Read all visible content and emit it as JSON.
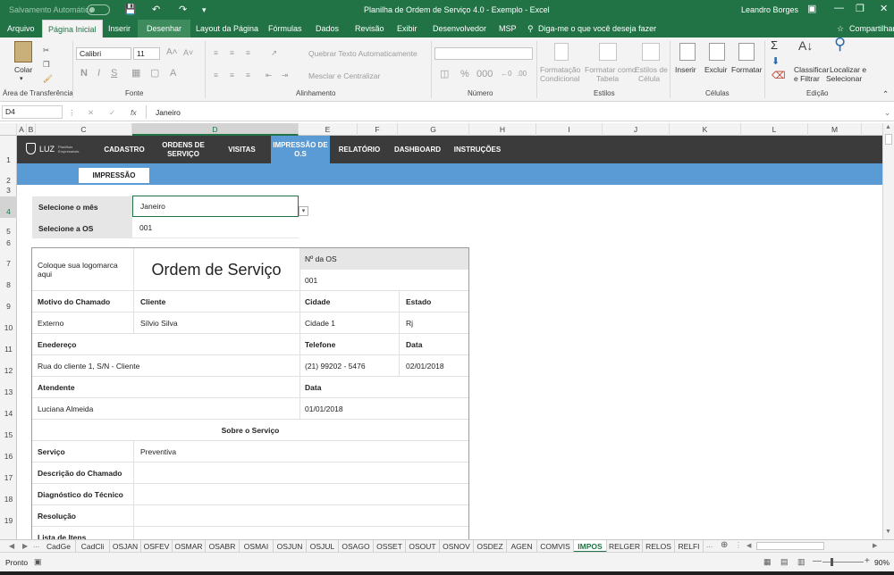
{
  "titlebar": {
    "autosave_label": "Salvamento Automático",
    "title": "Planilha de Ordem de Serviço 4.0 - Exemplo  -  Excel",
    "user": "Leandro Borges"
  },
  "menu": {
    "items": [
      "Arquivo",
      "Página Inicial",
      "Inserir",
      "Desenhar",
      "Layout da Página",
      "Fórmulas",
      "Dados",
      "Revisão",
      "Exibir",
      "Desenvolvedor",
      "MSP"
    ],
    "tell_me": "Diga-me o que você deseja fazer",
    "share": "Compartilhar"
  },
  "ribbon": {
    "paste": "Colar",
    "clipboard_group": "Área de Transferência",
    "font_name": "Calibri",
    "font_size": "11",
    "font_group": "Fonte",
    "wrap_text": "Quebrar Texto Automaticamente",
    "merge_center": "Mesclar e Centralizar",
    "alignment_group": "Alinhamento",
    "number_group": "Número",
    "cond_format_1": "Formatação",
    "cond_format_2": "Condicional",
    "format_table_1": "Formatar como",
    "format_table_2": "Tabela",
    "cell_styles_1": "Estilos de",
    "cell_styles_2": "Célula",
    "styles_group": "Estilos",
    "insert": "Inserir",
    "delete": "Excluir",
    "format": "Formatar",
    "cells_group": "Células",
    "sort_1": "Classificar",
    "sort_2": "e Filtrar",
    "find_1": "Localizar e",
    "find_2": "Selecionar",
    "editing_group": "Edição"
  },
  "formula_bar": {
    "name_box": "D4",
    "fx": "fx",
    "formula": "Janeiro"
  },
  "columns": [
    "A",
    "B",
    "C",
    "D",
    "E",
    "F",
    "G",
    "H",
    "I",
    "J",
    "K",
    "L",
    "M"
  ],
  "rows": [
    "1",
    "2",
    "3",
    "4",
    "5",
    "6",
    "7",
    "8",
    "9",
    "10",
    "11",
    "12",
    "13",
    "14",
    "15",
    "16",
    "17",
    "18",
    "19"
  ],
  "app_nav": {
    "logo_text": "LUZ",
    "logo_sub": "Planilhas Empresariais",
    "items": [
      "CADASTRO",
      "ORDENS DE SERVIÇO",
      "VISITAS",
      "IMPRESSÃO DE O.S",
      "RELATÓRIO",
      "DASHBOARD",
      "INSTRUÇÕES"
    ],
    "subtab": "IMPRESSÃO"
  },
  "selectors": {
    "month_label": "Selecione o mês",
    "month_value": "Janeiro",
    "os_label": "Selecione a OS",
    "os_value": "001"
  },
  "order": {
    "logo_placeholder": "Coloque sua logomarca aqui",
    "title": "Ordem de Serviço",
    "os_number_label": "Nº da OS",
    "os_number": "001",
    "reason_label": "Motivo do Chamado",
    "client_label": "Cliente",
    "city_label": "Cidade",
    "state_label": "Estado",
    "reason": "Externo",
    "client": "Sílvio Silva",
    "city": "Cidade 1",
    "state": "Rj",
    "address_label": "Enedereço",
    "phone_label": "Telefone",
    "date_label": "Data",
    "address": "Rua do cliente 1, S/N - Cliente",
    "phone": "(21) 99202 - 5476",
    "date": "02/01/2018",
    "attendant_label": "Atendente",
    "date2_label": "Data",
    "attendant": "Luciana Almeida",
    "date2": "01/01/2018",
    "about_title": "Sobre o Serviço",
    "service_label": "Serviço",
    "service": "Preventiva",
    "description_label": "Descrição do Chamado",
    "diagnosis_label": "Diagnóstico do Técnico",
    "resolution_label": "Resolução",
    "items_label": "Lista de Itens"
  },
  "sheet_tabs": [
    "CadGe",
    "CadCli",
    "OSJAN",
    "OSFEV",
    "OSMAR",
    "OSABR",
    "OSMAI",
    "OSJUN",
    "OSJUL",
    "OSAGO",
    "OSSET",
    "OSOUT",
    "OSNOV",
    "OSDEZ",
    "AGEN",
    "COMVIS",
    "IMPOS",
    "RELGER",
    "RELOS",
    "RELFI"
  ],
  "active_sheet": "IMPOS",
  "status": {
    "ready": "Pronto",
    "zoom": "90%"
  },
  "colors": {
    "excel_green": "#217346",
    "nav_dark": "#3b3b3b",
    "accent_blue": "#5b9bd5"
  }
}
